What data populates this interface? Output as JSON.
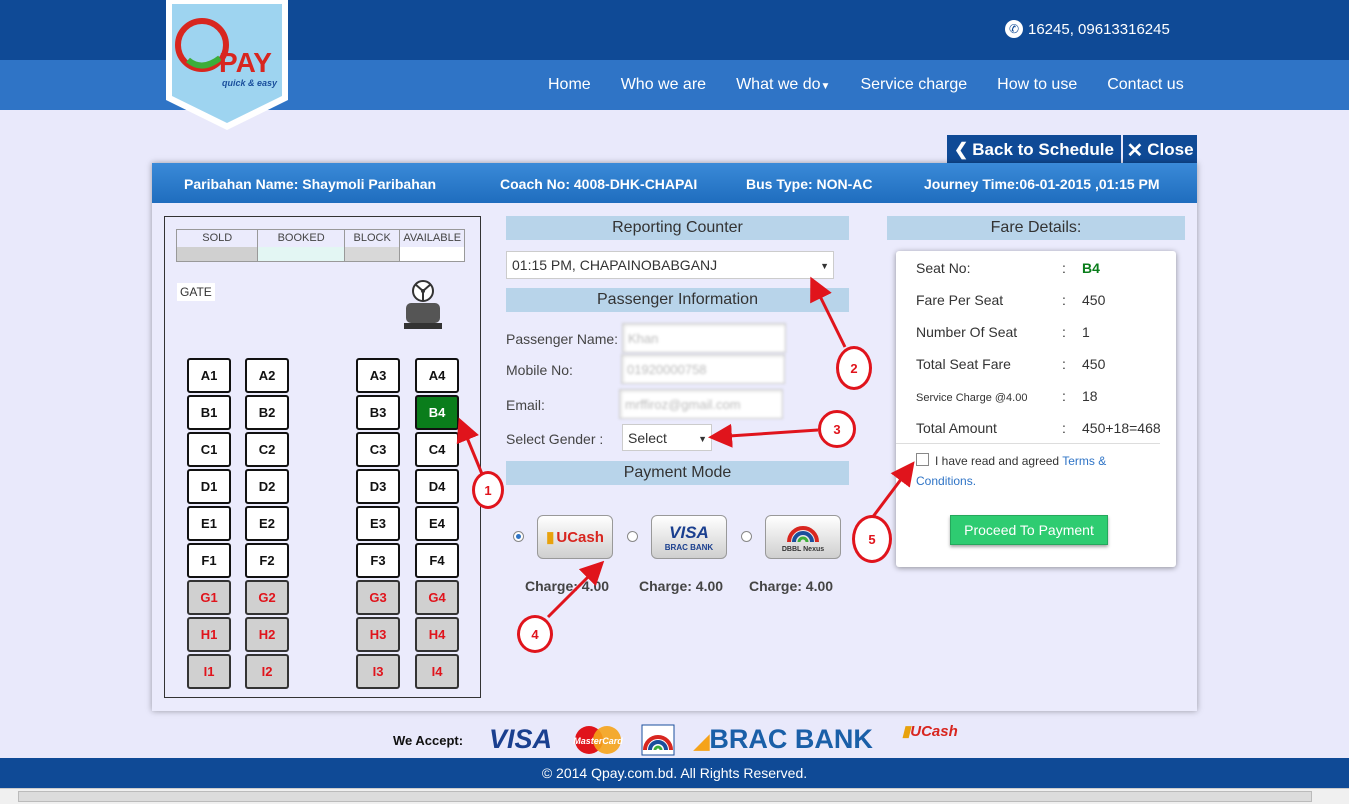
{
  "header": {
    "phone": "16245, 09613316245",
    "logo": {
      "brand": "PAY",
      "tagline": "quick & easy"
    },
    "nav": [
      "Home",
      "Who we are",
      "What we do",
      "Service charge",
      "How to use",
      "Contact us"
    ]
  },
  "actions": {
    "back": "Back to Schedule",
    "close": "Close"
  },
  "trip": {
    "paribahan": "Paribahan Name: Shaymoli Paribahan",
    "coach": "Coach No: 4008-DHK-CHAPAI",
    "bus_type": "Bus Type: NON-AC",
    "journey": "Journey Time:06-01-2015 ,01:15 PM"
  },
  "legend": [
    "SOLD",
    "BOOKED",
    "BLOCK",
    "AVAILABLE"
  ],
  "gate": "GATE",
  "seats": {
    "A": [
      "A1",
      "A2",
      "A3",
      "A4"
    ],
    "B": [
      "B1",
      "B2",
      "B3",
      "B4"
    ],
    "C": [
      "C1",
      "C2",
      "C3",
      "C4"
    ],
    "D": [
      "D1",
      "D2",
      "D3",
      "D4"
    ],
    "E": [
      "E1",
      "E2",
      "E3",
      "E4"
    ],
    "F": [
      "F1",
      "F2",
      "F3",
      "F4"
    ],
    "G": [
      "G1",
      "G2",
      "G3",
      "G4"
    ],
    "H": [
      "H1",
      "H2",
      "H3",
      "H4"
    ],
    "I": [
      "I1",
      "I2",
      "I3",
      "I4"
    ]
  },
  "reporting": {
    "title": "Reporting Counter",
    "selected": "01:15 PM, CHAPAINOBABGANJ"
  },
  "passenger": {
    "title": "Passenger Information",
    "name_label": "Passenger Name:",
    "name_value": "Khan",
    "mobile_label": "Mobile No:",
    "mobile_value": "01920000758",
    "email_label": "Email:",
    "email_value": "mrffiroz@gmail.com",
    "gender_label": "Select Gender :",
    "gender_value": "Select"
  },
  "payment": {
    "title": "Payment Mode",
    "options": [
      {
        "name": "UCash",
        "charge": "Charge: 4.00"
      },
      {
        "name": "VISA",
        "sub": "BRAC BANK",
        "charge": "Charge: 4.00"
      },
      {
        "name": "DBBL Nexus",
        "charge": "Charge: 4.00"
      }
    ]
  },
  "fare": {
    "title": "Fare Details:",
    "rows": [
      {
        "label": "Seat No:",
        "value": "B4"
      },
      {
        "label": "Fare Per Seat",
        "value": "450"
      },
      {
        "label": "Number Of Seat",
        "value": "1"
      },
      {
        "label": "Total Seat Fare",
        "value": "450"
      },
      {
        "label": "Service Charge @4.00",
        "value": "18"
      },
      {
        "label": "Total Amount",
        "value": "450+18=468"
      }
    ],
    "colon": ":",
    "terms_text": "I have read and agreed",
    "terms_link": "Terms & Conditions.",
    "proceed": "Proceed To Payment"
  },
  "annotations": [
    "1",
    "2",
    "3",
    "4",
    "5"
  ],
  "accept": {
    "label": "We Accept:",
    "brands": [
      "VISA",
      "MasterCard",
      "BRAC BANK",
      "UCash"
    ]
  },
  "footer": "© 2014 Qpay.com.bd. All Rights Reserved.",
  "colors": {
    "dark_blue": "#0f4a96",
    "nav_blue": "#2f74c6",
    "selected_seat": "#0a7d1b",
    "sold_text": "#e0141c",
    "proceed": "#2ecc71"
  }
}
